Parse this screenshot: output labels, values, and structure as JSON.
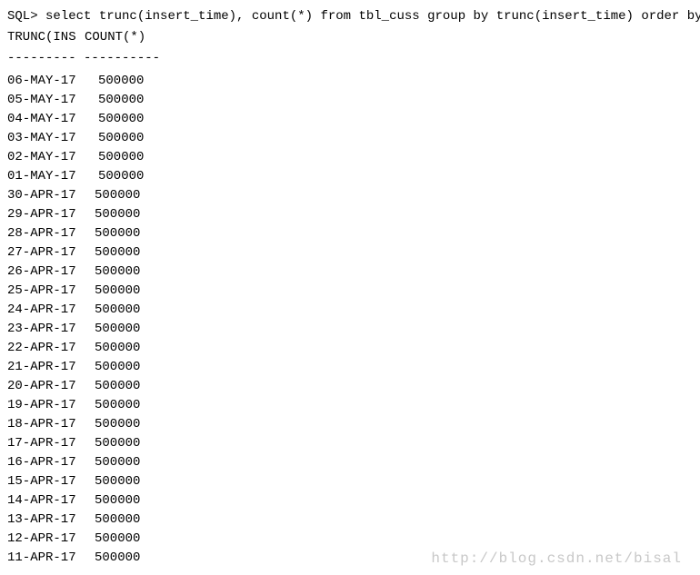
{
  "prompt": "SQL>",
  "query": "select trunc(insert_time), count(*) from tbl_cuss group by trunc(insert_time) order by trunc(insert_time) desc;",
  "header": {
    "col1": "TRUNC(INS",
    "col2": "COUNT(*)"
  },
  "divider": "--------- ----------",
  "rows": [
    {
      "date": "06-MAY-17",
      "count": "500000",
      "wide": true
    },
    {
      "date": "05-MAY-17",
      "count": "500000",
      "wide": true
    },
    {
      "date": "04-MAY-17",
      "count": "500000",
      "wide": true
    },
    {
      "date": "03-MAY-17",
      "count": "500000",
      "wide": true
    },
    {
      "date": "02-MAY-17",
      "count": "500000",
      "wide": true
    },
    {
      "date": "01-MAY-17",
      "count": "500000",
      "wide": true
    },
    {
      "date": "30-APR-17",
      "count": "500000",
      "wide": false
    },
    {
      "date": "29-APR-17",
      "count": "500000",
      "wide": false
    },
    {
      "date": "28-APR-17",
      "count": "500000",
      "wide": false
    },
    {
      "date": "27-APR-17",
      "count": "500000",
      "wide": false
    },
    {
      "date": "26-APR-17",
      "count": "500000",
      "wide": false
    },
    {
      "date": "25-APR-17",
      "count": "500000",
      "wide": false
    },
    {
      "date": "24-APR-17",
      "count": "500000",
      "wide": false
    },
    {
      "date": "23-APR-17",
      "count": "500000",
      "wide": false
    },
    {
      "date": "22-APR-17",
      "count": "500000",
      "wide": false
    },
    {
      "date": "21-APR-17",
      "count": "500000",
      "wide": false
    },
    {
      "date": "20-APR-17",
      "count": "500000",
      "wide": false
    },
    {
      "date": "19-APR-17",
      "count": "500000",
      "wide": false
    },
    {
      "date": "18-APR-17",
      "count": "500000",
      "wide": false
    },
    {
      "date": "17-APR-17",
      "count": "500000",
      "wide": false
    },
    {
      "date": "16-APR-17",
      "count": "500000",
      "wide": false
    },
    {
      "date": "15-APR-17",
      "count": "500000",
      "wide": false
    },
    {
      "date": "14-APR-17",
      "count": "500000",
      "wide": false
    },
    {
      "date": "13-APR-17",
      "count": "500000",
      "wide": false
    },
    {
      "date": "12-APR-17",
      "count": "500000",
      "wide": false
    },
    {
      "date": "11-APR-17",
      "count": "500000",
      "wide": false
    }
  ],
  "watermark": "http://blog.csdn.net/bisal"
}
